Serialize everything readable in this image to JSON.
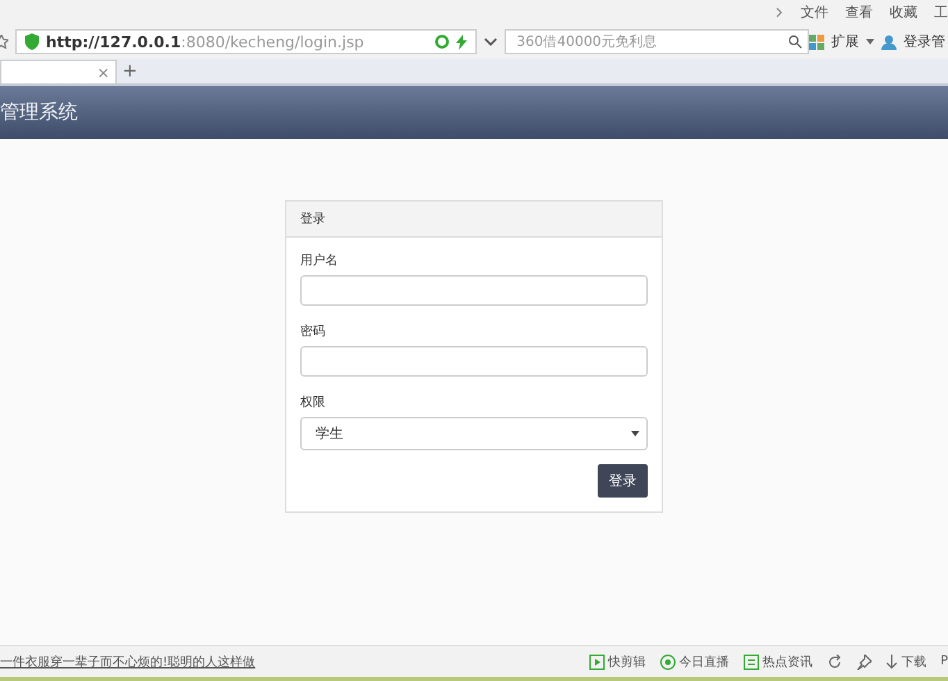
{
  "menu_bar": {
    "items": [
      "文件",
      "查看",
      "收藏",
      "工"
    ]
  },
  "address_bar": {
    "url_host": "http://127.0.0.1",
    "url_rest": ":8080/kecheng/login.jsp",
    "search_placeholder": "360借40000元免利息",
    "extensions_label": "扩展",
    "login_label": "登录管"
  },
  "tabs": [
    {
      "selected": true,
      "close": "×"
    }
  ],
  "new_tab": "+",
  "header": {
    "title": "管理系统"
  },
  "login_panel": {
    "heading": "登录",
    "fields": [
      {
        "kind": "text",
        "label": "用户名"
      },
      {
        "kind": "password",
        "label": "密码"
      },
      {
        "kind": "select",
        "label": "权限",
        "value": "学生"
      }
    ],
    "submit": "登录"
  },
  "status_bar": {
    "news": "一件衣服穿一辈子而不心烦的!聪明的人这样做",
    "items": [
      "快剪辑",
      "今日直播",
      "热点资讯"
    ],
    "download": "下载",
    "tail": "P"
  }
}
